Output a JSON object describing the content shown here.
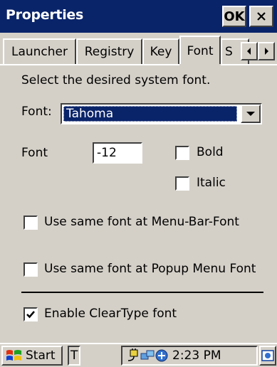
{
  "window": {
    "title": "Properties",
    "ok_label": "OK"
  },
  "tabs": [
    {
      "label": "Launcher"
    },
    {
      "label": "Registry"
    },
    {
      "label": "Key"
    },
    {
      "label": "Font",
      "active": true
    },
    {
      "label": "S"
    }
  ],
  "content": {
    "instruction": "Select the desired system font.",
    "font_label": "Font:",
    "font_selected": "Tahoma",
    "size_label": "Font",
    "size_value": "-12",
    "bold_label": "Bold",
    "bold_checked": false,
    "italic_label": "Italic",
    "italic_checked": false,
    "menubar_label": "Use same font at Menu-Bar-Font",
    "menubar_checked": false,
    "popup_label": "Use same font at Popup Menu Font",
    "popup_checked": false,
    "cleartype_label": "Enable ClearType font",
    "cleartype_checked": true
  },
  "taskbar": {
    "start_label": "Start",
    "task_label": "T",
    "clock": "2:23 PM"
  },
  "colors": {
    "titlebar": "#0a246a",
    "face": "#d4d0c8",
    "selection": "#0a246a"
  }
}
